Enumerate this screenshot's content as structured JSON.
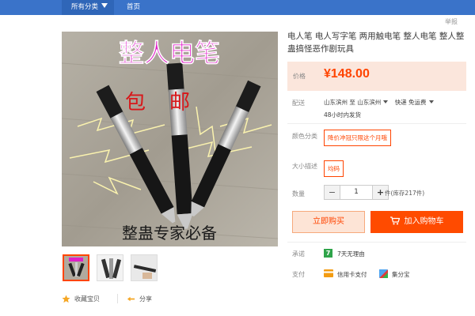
{
  "nav": {
    "all_categories": "所有分类",
    "home": "首页",
    "report": "举报"
  },
  "image_text": {
    "headline": "整人电笔",
    "free_ship": "包邮",
    "slogan": "整蛊专家必备"
  },
  "product": {
    "title": "电人笔 电人写字笔 两用触电笔 整人电笔 整人整蛊搞怪恶作剧玩具",
    "price_label": "价格",
    "price": "¥148.00"
  },
  "shipping": {
    "label": "配送",
    "from": "山东滨州",
    "to_word": "至",
    "to": "山东滨州",
    "method": "快递 免运费",
    "note": "48小时内发货"
  },
  "color": {
    "label": "颜色分类",
    "option": "降价冲冠只限这个月哦"
  },
  "size": {
    "label": "大小描述",
    "option": "均码"
  },
  "quantity": {
    "label": "数量",
    "minus": "−",
    "value": "1",
    "plus": "+",
    "stock": "件(库存217件)"
  },
  "actions": {
    "buy_now": "立即购买",
    "add_cart": "加入购物车",
    "favorite": "收藏宝贝",
    "share": "分享"
  },
  "pledge": {
    "label": "承诺",
    "icon_char": "7",
    "text": "7天无理由"
  },
  "payment": {
    "label": "支付",
    "card": "信用卡支付",
    "jifen": "集分宝"
  },
  "colors": {
    "accent": "#ff4400",
    "nav_blue": "#3a73c9",
    "price_bg": "#fbe6dc",
    "headline": "#e01fc8"
  }
}
